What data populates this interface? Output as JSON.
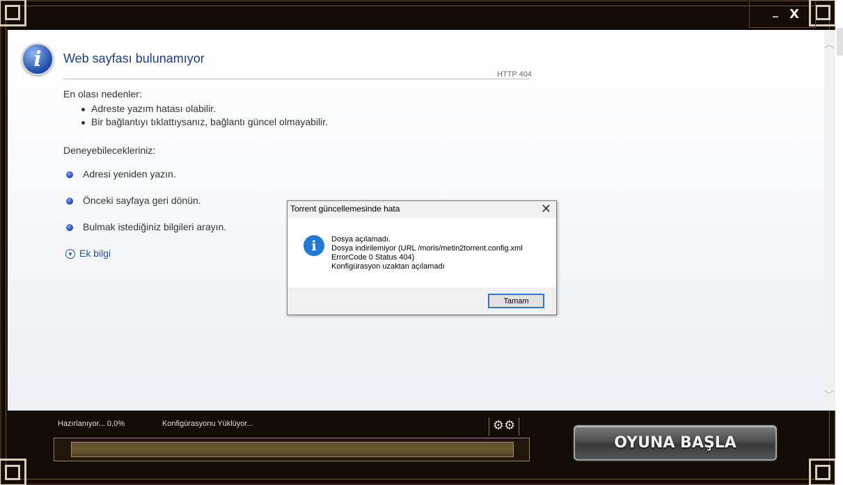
{
  "window": {
    "minimize_label": "_",
    "close_label": "X"
  },
  "browser": {
    "title": "Web sayfası bulunamıyor",
    "http_code": "HTTP 404",
    "causes_heading": "En olası nedenler:",
    "causes": [
      "Adreste yazım hatası olabilir.",
      "Bir bağlantıyı tıklattıysanız, bağlantı güncel olmayabilir."
    ],
    "try_heading": "Deneyebilecekleriniz:",
    "try_items": [
      "Adresi yeniden yazın.",
      "Önceki sayfaya geri dönün.",
      "Bulmak  istediğiniz bilgileri arayın."
    ],
    "more_info": "Ek bilgi"
  },
  "dialog": {
    "title": "Torrent güncellemesinde hata",
    "close_label": "✕",
    "message": "Dosya açılamadı.\nDosya indirilemiyor (URL /moris/metin2torrent.config.xml\nErrorCode 0 Status 404)\nKonfigürasyon uzaktan açılamadı",
    "ok_label": "Tamam"
  },
  "status": {
    "progress_text": "Hazırlanıyor... 0,0%",
    "progress_value": 0.0,
    "config_text": "Konfigürasyonu Yüklüyor..."
  },
  "play_button": "OYUNA BAŞLA",
  "icons": {
    "settings": "gears-icon",
    "info": "info-icon"
  }
}
